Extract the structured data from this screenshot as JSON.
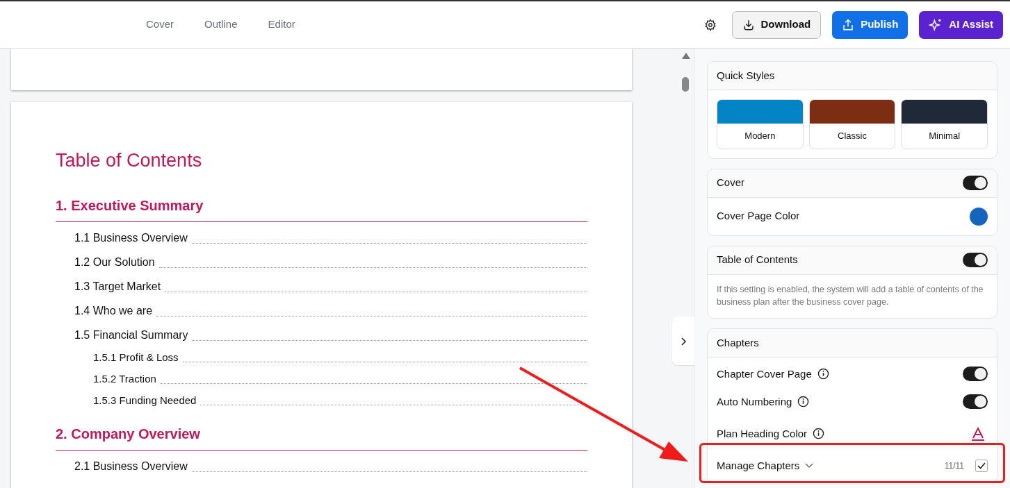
{
  "nav": {
    "tabs": [
      {
        "label": "Cover",
        "selected": false
      },
      {
        "label": "Outline",
        "selected": false
      },
      {
        "label": "Editor",
        "selected": false
      }
    ]
  },
  "actions": [
    {
      "kind": "settings"
    },
    {
      "kind": "download",
      "label": "Download"
    },
    {
      "kind": "publish",
      "label": "Publish"
    },
    {
      "kind": "ai",
      "label": "AI Assist"
    }
  ],
  "document": {
    "title": "Table of Contents",
    "sections": [
      {
        "title": "1. Executive Summary",
        "entries": [
          {
            "label": "1.1 Business Overview"
          },
          {
            "label": "1.2 Our Solution"
          },
          {
            "label": "1.3 Target Market"
          },
          {
            "label": "1.4 Who we are"
          },
          {
            "label": "1.5 Financial Summary",
            "children": [
              {
                "label": "1.5.1 Profit & Loss"
              },
              {
                "label": "1.5.2 Traction"
              },
              {
                "label": "1.5.3 Funding Needed"
              }
            ]
          }
        ]
      },
      {
        "title": "2. Company Overview",
        "entries": [
          {
            "label": "2.1 Business Overview"
          }
        ]
      }
    ]
  },
  "panel": {
    "quick_styles": {
      "title": "Quick Styles",
      "styles": [
        {
          "label": "Modern",
          "color": "#0284c7"
        },
        {
          "label": "Classic",
          "color": "#7c2d12"
        },
        {
          "label": "Minimal",
          "color": "#1f2937"
        }
      ]
    },
    "cover": {
      "title": "Cover",
      "on": true,
      "rows": [
        {
          "label": "Cover Page Color",
          "color": "#1565c0"
        }
      ]
    },
    "toc": {
      "title": "Table of Contents",
      "on": true,
      "description": "If this setting is enabled, the system will add a table of contents of the business plan after the business cover page."
    },
    "chapters": {
      "title": "Chapters",
      "rows": [
        {
          "kind": "toggle",
          "label": "Chapter Cover Page",
          "on": true
        },
        {
          "kind": "toggle",
          "label": "Auto Numbering",
          "on": true
        },
        {
          "kind": "color",
          "label": "Plan Heading Color",
          "color": "#c2185b"
        },
        {
          "kind": "manage",
          "label": "Manage Chapters",
          "count": "11/11",
          "checked": true
        }
      ]
    }
  }
}
